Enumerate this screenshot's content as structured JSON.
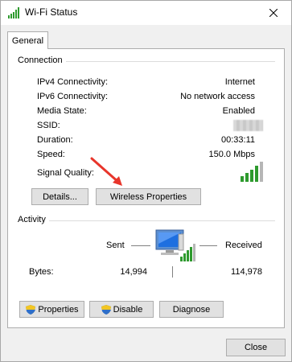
{
  "window": {
    "title": "Wi-Fi Status"
  },
  "tabs": [
    {
      "label": "General"
    }
  ],
  "connection": {
    "heading": "Connection",
    "rows": [
      {
        "label": "IPv4 Connectivity:",
        "value": "Internet"
      },
      {
        "label": "IPv6 Connectivity:",
        "value": "No network access"
      },
      {
        "label": "Media State:",
        "value": "Enabled"
      },
      {
        "label": "SSID:",
        "value": ""
      },
      {
        "label": "Duration:",
        "value": "00:33:11"
      },
      {
        "label": "Speed:",
        "value": "150.0 Mbps"
      }
    ],
    "signal_label": "Signal Quality:",
    "signal_bars": 5,
    "signal_bars_filled": 4,
    "details_button": "Details...",
    "wireless_properties_button": "Wireless Properties"
  },
  "activity": {
    "heading": "Activity",
    "sent_label": "Sent",
    "received_label": "Received",
    "bytes_label": "Bytes:",
    "bytes_sent": "14,994",
    "bytes_received": "114,978"
  },
  "actions": {
    "properties_button": "Properties",
    "disable_button": "Disable",
    "diagnose_button": "Diagnose"
  },
  "footer": {
    "close_button": "Close"
  },
  "colors": {
    "signal_green": "#2e9a2e",
    "arrow_red": "#e8352b",
    "shield_blue": "#2f6fc9",
    "shield_yellow": "#f3c623"
  },
  "icons": [
    "wifi-signal-icon",
    "network-computer-icon",
    "shield-icon",
    "close-icon",
    "red-arrow-icon"
  ]
}
